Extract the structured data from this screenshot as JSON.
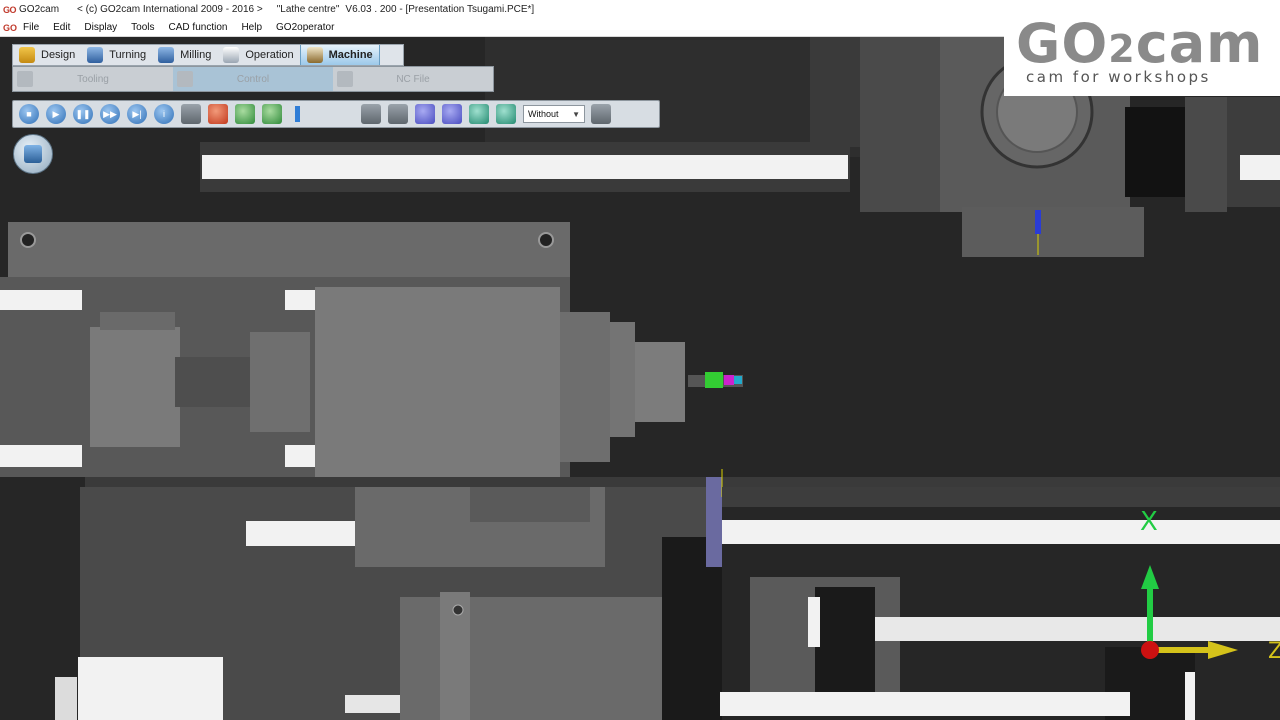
{
  "title_bar": {
    "app_name": "GO2cam",
    "copyright": "< (c) GO2cam International 2009 - 2016 >",
    "machine": "\"Lathe centre\"",
    "version": "V6.03 . 200 - [Presentation Tsugami.PCE*]"
  },
  "menu": {
    "items": [
      "File",
      "Edit",
      "Display",
      "Tools",
      "CAD function",
      "Help",
      "GO2operator"
    ]
  },
  "brand": {
    "name_a": "GO",
    "name_b": "2",
    "name_c": "cam",
    "tagline": "cam for workshops"
  },
  "tabs": [
    {
      "label": "Design"
    },
    {
      "label": "Turning"
    },
    {
      "label": "Milling"
    },
    {
      "label": "Operation"
    },
    {
      "label": "Machine",
      "active": true
    }
  ],
  "subtabs": [
    "Tooling",
    "Control",
    "NC File"
  ],
  "toolbar": {
    "view_mode": "Without"
  },
  "axes": {
    "x_label": "X",
    "z_label": "Z"
  },
  "colors": {
    "axis_x": "#22cc44",
    "axis_z": "#d4c21a",
    "origin": "#cc1111",
    "active_tab": "#9cc9ea"
  }
}
